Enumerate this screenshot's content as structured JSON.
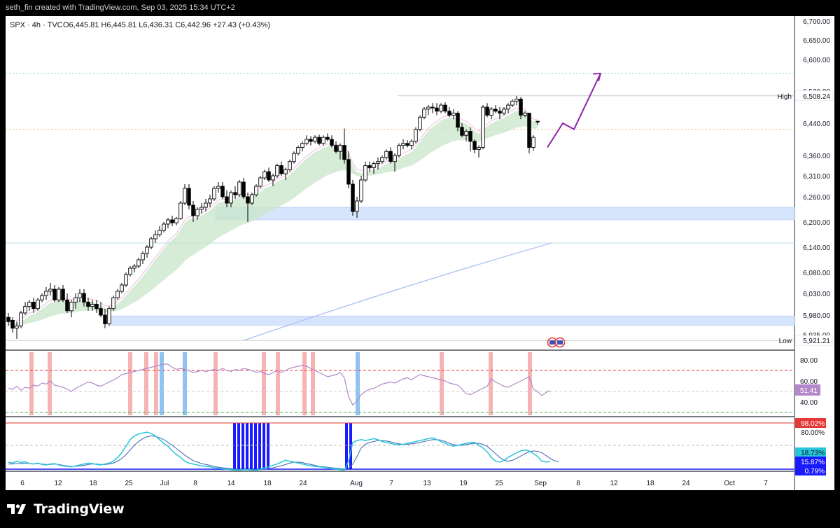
{
  "header": {
    "caption": "seth_fin created with TradingView.com, Sep 03, 2025 15:34 UTC+2"
  },
  "legend": {
    "symbol": "SPX · 4h · TVC",
    "ohlc": "O6,445.81  H6,445.81  L6,436.31  C6,442.96  +27.43 (+0.43%)"
  },
  "brand": {
    "name": "TradingView"
  },
  "colors": {
    "up": "#ffffff",
    "down": "#000000",
    "cloud": "#c8e6c9",
    "zone": "#cfe0fb",
    "forecast": "#8e24aa",
    "sma": "#b0c4f0",
    "rsi": "#b388c9",
    "overbought": "#f5b3b5",
    "oversold": "#90c2f2"
  },
  "chart_data": [
    {
      "type": "candlestick",
      "title": "SPX · 4h · TVC",
      "yticks": [
        "6,700.00",
        "6,650.00",
        "6,600.00",
        "6,520.00",
        "6,440.00",
        "6,360.00",
        "6,310.00",
        "6,260.00",
        "6,200.00",
        "6,140.00",
        "6,080.00",
        "6,030.00",
        "5,980.00",
        "5,935.00"
      ],
      "y_scale": [
        [
          6700,
          30
        ],
        [
          6650,
          57
        ],
        [
          6600,
          85
        ],
        [
          6520,
          130
        ],
        [
          6440,
          176
        ],
        [
          6360,
          222
        ],
        [
          6310,
          251
        ],
        [
          6260,
          281
        ],
        [
          6200,
          317
        ],
        [
          6140,
          353
        ],
        [
          6080,
          389
        ],
        [
          6030,
          419
        ],
        [
          5980,
          450
        ],
        [
          5935,
          478
        ]
      ],
      "x_ticks": [
        "6",
        "12",
        "18",
        "25",
        "Jul",
        "8",
        "14",
        "18",
        "24",
        "Aug",
        "7",
        "13",
        "19",
        "25",
        "Sep",
        "8",
        "12",
        "18",
        "24",
        "Oct",
        "7"
      ],
      "high_label": "High",
      "high_value": "6,508.24",
      "low_label": "Low",
      "low_value": "5,921.21",
      "candles": [
        [
          5975,
          5985,
          5955,
          5965
        ],
        [
          5968,
          5975,
          5940,
          5950
        ],
        [
          5950,
          5965,
          5925,
          5955
        ],
        [
          5955,
          5990,
          5950,
          5985
        ],
        [
          5985,
          6010,
          5980,
          6000
        ],
        [
          6000,
          6015,
          5990,
          6010
        ],
        [
          6010,
          6020,
          5985,
          5995
        ],
        [
          5995,
          6020,
          5990,
          6015
        ],
        [
          6015,
          6030,
          6010,
          6025
        ],
        [
          6025,
          6045,
          6015,
          6035
        ],
        [
          6035,
          6055,
          6025,
          6040
        ],
        [
          6040,
          6050,
          6010,
          6015
        ],
        [
          6015,
          6045,
          6010,
          6040
        ],
        [
          6040,
          6050,
          6010,
          6015
        ],
        [
          6015,
          6030,
          5985,
          5990
        ],
        [
          5990,
          6015,
          5975,
          6010
        ],
        [
          6010,
          6030,
          5995,
          6020
        ],
        [
          6020,
          6040,
          6010,
          6030
        ],
        [
          6030,
          6040,
          6000,
          6010
        ],
        [
          6010,
          6020,
          5990,
          6000
        ],
        [
          6000,
          6015,
          5990,
          6005
        ],
        [
          6005,
          6015,
          5985,
          5995
        ],
        [
          5995,
          6010,
          5975,
          5980
        ],
        [
          5980,
          5995,
          5950,
          5960
        ],
        [
          5960,
          6000,
          5955,
          5995
        ],
        [
          5995,
          6025,
          5990,
          6020
        ],
        [
          6020,
          6040,
          6015,
          6035
        ],
        [
          6035,
          6055,
          6030,
          6050
        ],
        [
          6050,
          6080,
          6045,
          6075
        ],
        [
          6075,
          6095,
          6070,
          6090
        ],
        [
          6090,
          6100,
          6080,
          6095
        ],
        [
          6095,
          6115,
          6090,
          6110
        ],
        [
          6110,
          6130,
          6100,
          6125
        ],
        [
          6125,
          6145,
          6115,
          6140
        ],
        [
          6140,
          6165,
          6135,
          6160
        ],
        [
          6160,
          6180,
          6150,
          6170
        ],
        [
          6170,
          6190,
          6165,
          6180
        ],
        [
          6180,
          6200,
          6175,
          6195
        ],
        [
          6195,
          6210,
          6185,
          6205
        ],
        [
          6205,
          6215,
          6190,
          6198
        ],
        [
          6198,
          6212,
          6192,
          6208
        ],
        [
          6208,
          6250,
          6205,
          6245
        ],
        [
          6245,
          6290,
          6240,
          6280
        ],
        [
          6280,
          6290,
          6230,
          6240
        ],
        [
          6240,
          6250,
          6200,
          6215
        ],
        [
          6215,
          6235,
          6205,
          6230
        ],
        [
          6230,
          6245,
          6220,
          6235
        ],
        [
          6235,
          6255,
          6225,
          6245
        ],
        [
          6245,
          6265,
          6235,
          6255
        ],
        [
          6255,
          6285,
          6250,
          6280
        ],
        [
          6280,
          6295,
          6270,
          6285
        ],
        [
          6285,
          6295,
          6255,
          6260
        ],
        [
          6260,
          6275,
          6235,
          6245
        ],
        [
          6245,
          6275,
          6235,
          6270
        ],
        [
          6270,
          6285,
          6255,
          6265
        ],
        [
          6265,
          6300,
          6260,
          6295
        ],
        [
          6295,
          6305,
          6255,
          6260
        ],
        [
          6260,
          6270,
          6200,
          6245
        ],
        [
          6245,
          6270,
          6240,
          6265
        ],
        [
          6265,
          6290,
          6260,
          6285
        ],
        [
          6285,
          6310,
          6280,
          6305
        ],
        [
          6305,
          6325,
          6300,
          6320
        ],
        [
          6320,
          6330,
          6295,
          6300
        ],
        [
          6300,
          6315,
          6285,
          6310
        ],
        [
          6310,
          6340,
          6305,
          6335
        ],
        [
          6335,
          6345,
          6310,
          6315
        ],
        [
          6315,
          6330,
          6300,
          6325
        ],
        [
          6325,
          6350,
          6320,
          6345
        ],
        [
          6345,
          6370,
          6340,
          6365
        ],
        [
          6365,
          6385,
          6360,
          6380
        ],
        [
          6380,
          6395,
          6370,
          6390
        ],
        [
          6390,
          6410,
          6385,
          6400
        ],
        [
          6400,
          6408,
          6385,
          6395
        ],
        [
          6395,
          6410,
          6390,
          6405
        ],
        [
          6405,
          6412,
          6385,
          6390
        ],
        [
          6390,
          6410,
          6385,
          6405
        ],
        [
          6405,
          6415,
          6395,
          6400
        ],
        [
          6400,
          6410,
          6380,
          6385
        ],
        [
          6385,
          6395,
          6365,
          6370
        ],
        [
          6370,
          6390,
          6350,
          6385
        ],
        [
          6385,
          6427,
          6340,
          6350
        ],
        [
          6350,
          6370,
          6280,
          6290
        ],
        [
          6290,
          6300,
          6215,
          6225
        ],
        [
          6225,
          6260,
          6210,
          6250
        ],
        [
          6250,
          6310,
          6245,
          6300
        ],
        [
          6300,
          6345,
          6295,
          6335
        ],
        [
          6335,
          6345,
          6320,
          6330
        ],
        [
          6330,
          6345,
          6315,
          6340
        ],
        [
          6340,
          6355,
          6325,
          6345
        ],
        [
          6345,
          6360,
          6340,
          6355
        ],
        [
          6355,
          6375,
          6350,
          6370
        ],
        [
          6370,
          6380,
          6340,
          6345
        ],
        [
          6345,
          6365,
          6320,
          6360
        ],
        [
          6360,
          6390,
          6355,
          6385
        ],
        [
          6385,
          6400,
          6375,
          6390
        ],
        [
          6390,
          6398,
          6380,
          6385
        ],
        [
          6385,
          6400,
          6375,
          6395
        ],
        [
          6395,
          6430,
          6390,
          6425
        ],
        [
          6425,
          6460,
          6420,
          6455
        ],
        [
          6455,
          6480,
          6450,
          6475
        ],
        [
          6475,
          6485,
          6460,
          6480
        ],
        [
          6480,
          6490,
          6465,
          6478
        ],
        [
          6478,
          6490,
          6460,
          6470
        ],
        [
          6470,
          6490,
          6465,
          6485
        ],
        [
          6485,
          6492,
          6465,
          6470
        ],
        [
          6470,
          6480,
          6455,
          6460
        ],
        [
          6460,
          6475,
          6450,
          6465
        ],
        [
          6465,
          6470,
          6420,
          6430
        ],
        [
          6430,
          6440,
          6405,
          6410
        ],
        [
          6410,
          6425,
          6395,
          6420
        ],
        [
          6420,
          6430,
          6370,
          6395
        ],
        [
          6395,
          6400,
          6365,
          6375
        ],
        [
          6375,
          6385,
          6355,
          6380
        ],
        [
          6380,
          6485,
          6375,
          6480
        ],
        [
          6480,
          6490,
          6455,
          6460
        ],
        [
          6460,
          6480,
          6450,
          6475
        ],
        [
          6475,
          6485,
          6465,
          6470
        ],
        [
          6470,
          6480,
          6450,
          6465
        ],
        [
          6465,
          6480,
          6460,
          6475
        ],
        [
          6475,
          6490,
          6465,
          6485
        ],
        [
          6485,
          6500,
          6480,
          6495
        ],
        [
          6495,
          6508,
          6485,
          6500
        ],
        [
          6500,
          6505,
          6450,
          6460
        ],
        [
          6460,
          6470,
          6455,
          6465
        ],
        [
          6465,
          6466,
          6365,
          6380
        ],
        [
          6380,
          6410,
          6372,
          6405
        ],
        [
          6445,
          6446,
          6436,
          6443
        ]
      ],
      "forecast_path": [
        [
          6380,
          6505
        ],
        [
          6440,
          6520
        ],
        [
          6425,
          6545
        ],
        [
          6565,
          6570
        ]
      ],
      "zones": [
        [
          6235,
          6205
        ],
        [
          5978,
          5957
        ]
      ]
    },
    {
      "type": "line",
      "title": "RSI",
      "yticks": [
        "80.00",
        "60.00",
        "40.00"
      ],
      "y_scale": [
        [
          80,
          514
        ],
        [
          60,
          544
        ],
        [
          40,
          574
        ]
      ],
      "last_value": "51.41",
      "levels": [
        70,
        30
      ],
      "values": [
        53,
        52,
        55,
        51,
        54,
        53,
        56,
        55,
        58,
        57,
        60,
        56,
        55,
        54,
        52,
        50,
        53,
        55,
        57,
        59,
        58,
        56,
        55,
        57,
        59,
        61,
        63,
        66,
        67,
        68,
        69,
        70,
        71,
        72,
        73,
        74,
        75,
        76,
        76,
        73,
        71,
        72,
        71,
        70,
        68,
        69,
        70,
        69,
        70,
        71,
        70,
        72,
        70,
        69,
        71,
        70,
        72,
        71,
        70,
        68,
        69,
        67,
        66,
        68,
        70,
        68,
        70,
        72,
        73,
        74,
        75,
        74,
        72,
        70,
        68,
        66,
        64,
        65,
        66,
        68,
        63,
        45,
        37,
        41,
        47,
        50,
        52,
        53,
        55,
        57,
        58,
        59,
        58,
        60,
        62,
        63,
        61,
        64,
        66,
        65,
        64,
        63,
        62,
        61,
        60,
        58,
        57,
        56,
        52,
        48,
        47,
        49,
        51,
        53,
        55,
        62,
        59,
        57,
        55,
        54,
        56,
        58,
        60,
        62,
        64,
        52,
        50,
        46,
        49,
        51
      ]
    },
    {
      "type": "line",
      "title": "Stochastic RSI",
      "yticks": [
        "98.02%",
        "80.00%",
        "18.73%",
        "15.87%",
        "0.79%"
      ],
      "values_k": [
        18,
        16,
        20,
        17,
        19,
        15,
        14,
        16,
        13,
        12,
        14,
        15,
        12,
        10,
        9,
        8,
        10,
        12,
        14,
        16,
        15,
        13,
        12,
        14,
        16,
        20,
        28,
        38,
        52,
        66,
        74,
        78,
        80,
        82,
        79,
        74,
        66,
        58,
        52,
        42,
        34,
        28,
        20,
        16,
        14,
        12,
        10,
        9,
        8,
        6,
        5,
        4,
        3,
        2,
        1,
        1,
        2,
        2,
        1,
        1,
        3,
        6,
        8,
        11,
        14,
        18,
        22,
        20,
        18,
        16,
        14,
        12,
        10,
        9,
        8,
        7,
        6,
        4,
        3,
        2,
        1,
        20,
        60,
        64,
        66,
        64,
        66,
        68,
        66,
        62,
        60,
        58,
        56,
        55,
        56,
        58,
        60,
        62,
        64,
        66,
        68,
        70,
        66,
        62,
        58,
        54,
        52,
        54,
        56,
        58,
        60,
        60,
        54,
        48,
        40,
        28,
        20,
        18,
        22,
        28,
        33,
        38,
        42,
        44,
        42,
        36,
        30,
        20,
        18,
        19
      ],
      "values_d": [
        14,
        14,
        15,
        15,
        16,
        15,
        14,
        15,
        14,
        13,
        13,
        14,
        13,
        11,
        10,
        9,
        9,
        10,
        11,
        13,
        14,
        14,
        13,
        13,
        14,
        16,
        20,
        26,
        34,
        44,
        54,
        62,
        68,
        72,
        74,
        73,
        70,
        66,
        60,
        54,
        47,
        40,
        33,
        27,
        21,
        18,
        15,
        13,
        11,
        9,
        7,
        6,
        5,
        4,
        3,
        2,
        2,
        2,
        2,
        1,
        2,
        3,
        4,
        6,
        8,
        10,
        13,
        16,
        18,
        18,
        17,
        15,
        13,
        11,
        9,
        8,
        7,
        6,
        5,
        4,
        3,
        5,
        14,
        30,
        48,
        56,
        60,
        62,
        64,
        64,
        63,
        61,
        59,
        57,
        56,
        56,
        57,
        58,
        60,
        62,
        64,
        66,
        66,
        65,
        62,
        58,
        55,
        54,
        54,
        55,
        57,
        58,
        58,
        56,
        52,
        44,
        36,
        28,
        22,
        20,
        22,
        26,
        31,
        36,
        40,
        42,
        41,
        38,
        32,
        26,
        21,
        19
      ]
    }
  ]
}
